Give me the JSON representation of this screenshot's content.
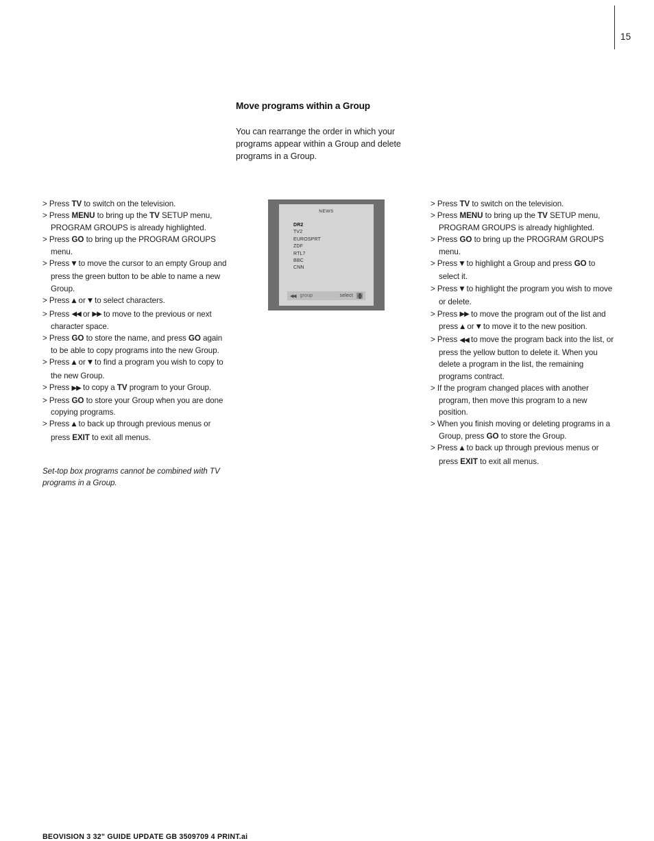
{
  "page": {
    "number": "15",
    "footer": "BEOVISION 3 32\" GUIDE UPDATE GB 3509709 4 PRINT.ai"
  },
  "intro": {
    "heading": "Move programs within a Group",
    "body": "You can rearrange the order in which your programs appear within a Group and delete programs in a Group."
  },
  "left_column": {
    "steps": [
      "Press TV to switch on the television.",
      "Press MENU to bring up the TV SETUP menu, PROGRAM GROUPS is already highlighted.",
      "Press GO to bring up the PROGRAM GROUPS menu.",
      "Press ▼ to move the cursor to an empty Group and press the green button to be able to name a new Group.",
      "Press ▲ or ▼ to select characters.",
      "Press ◀◀ or ▶▶ to move to the previous or next character space.",
      "Press GO to store the name, and press GO again to be able to copy programs into the new Group.",
      "Press ▲ or ▼ to find a program you wish to copy to the new Group.",
      "Press ▶▶ to copy a TV program to your Group.",
      "Press GO to store your Group when you are done copying programs.",
      "Press ▲ to back up through previous menus or press EXIT to exit all menus."
    ],
    "note": "Set-top box programs cannot be combined with TV programs in a Group."
  },
  "right_column": {
    "steps": [
      "Press TV to switch on the television.",
      "Press MENU to bring up the TV SETUP menu, PROGRAM GROUPS is already highlighted.",
      "Press GO to bring up the PROGRAM GROUPS menu.",
      "Press ▼ to highlight a Group and press GO to select it.",
      "Press ▼ to highlight the program you wish to move or delete.",
      "Press ▶▶ to move the program out of the list and press ▲ or ▼ to move it to the new position.",
      "Press ◀◀ to move the program back into the list, or press the yellow button to delete it. When you delete a program in the list, the remaining programs contract.",
      "If the program changed places with another program, then move this program to a new position.",
      "When you finish moving or deleting programs in a Group, press GO to store the Group.",
      "Press ▲ to back up through previous menus or press EXIT to exit all menus."
    ]
  },
  "tv_illustration": {
    "title": "NEWS",
    "programs": [
      {
        "name": "DR2",
        "selected": true
      },
      {
        "name": "TV2",
        "selected": false
      },
      {
        "name": "EUROSPRT",
        "selected": false
      },
      {
        "name": "ZDF",
        "selected": false
      },
      {
        "name": "RTL7",
        "selected": false
      },
      {
        "name": "BBC",
        "selected": false
      },
      {
        "name": "CNN",
        "selected": false
      }
    ],
    "bar": {
      "rewind_icon": "◀◀",
      "left_label": "group",
      "right_label": "select",
      "go_icon": "go-button-icon"
    },
    "colors": {
      "frame": "#6e6e6e",
      "screen": "#d4d4d4",
      "bar": "#bfbfbf"
    }
  },
  "keywords": [
    "TV",
    "MENU",
    "GO",
    "EXIT"
  ]
}
